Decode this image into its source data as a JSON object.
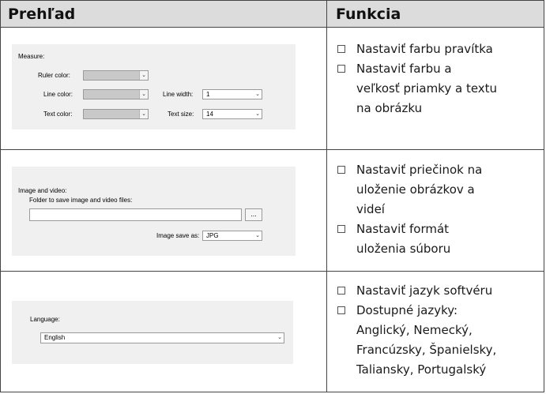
{
  "header": {
    "left": "Prehľad",
    "right": "Funkcia"
  },
  "rows": [
    {
      "panel": {
        "title": "Measure:",
        "ruler_label": "Ruler color:",
        "line_label": "Line color:",
        "text_label": "Text color:",
        "line_width_label": "Line width:",
        "line_width_value": "1",
        "text_size_label": "Text size:",
        "text_size_value": "14"
      },
      "functions": [
        [
          "Nastaviť farbu pravítka"
        ],
        [
          "Nastaviť farbu a",
          "veľkosť priamky a textu",
          "na obrázku"
        ]
      ]
    },
    {
      "panel": {
        "title": "Image and video:",
        "folder_label": "Folder to save image and video files:",
        "browse_label": "...",
        "save_as_label": "Image save as:",
        "save_as_value": "JPG"
      },
      "functions": [
        [
          "Nastaviť priečinok na",
          "uloženie obrázkov a",
          "videí"
        ],
        [
          "Nastaviť formát",
          "uloženia súboru"
        ]
      ]
    },
    {
      "panel": {
        "title": "Language:",
        "value": "English"
      },
      "functions": [
        [
          "Nastaviť jazyk softvéru"
        ],
        [
          "Dostupné jazyky:",
          "Anglický, Nemecký,",
          "Francúzsky, Španielsky,",
          "Taliansky, Portugalský"
        ]
      ]
    }
  ],
  "icons": {
    "dropdown": "chevron-down-icon",
    "bullet": "checkbox-square-icon"
  }
}
